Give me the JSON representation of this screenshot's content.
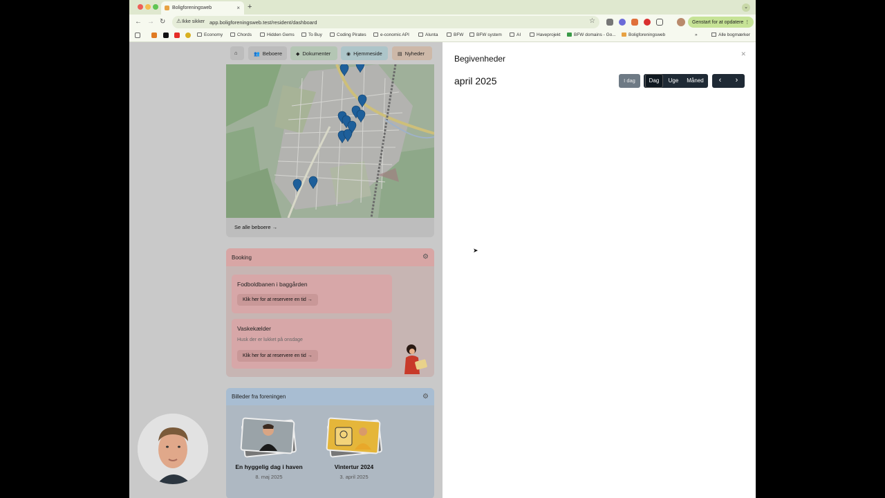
{
  "browser": {
    "tab_title": "Boligforeningsweb",
    "security_label": "Ikke sikker",
    "url": "app.boligforeningsweb.test/resident/dashboard",
    "relaunch_label": "Genstart for at opdatere",
    "bookmarks": [
      "Economy",
      "Chords",
      "Hidden Gems",
      "To Buy",
      "Coding Pirates",
      "e-conomic API",
      "Alunta",
      "BFW",
      "BFW system",
      "AI",
      "Haveprojekt",
      "BFW domains - Go...",
      "Boligforeningsweb"
    ],
    "all_bookmarks": "Alle bogmærker"
  },
  "nav": {
    "items": [
      "Beboere",
      "Dokumenter",
      "Hjemmeside",
      "Nyheder"
    ]
  },
  "map_card": {
    "see_all": "Se alle beboere →"
  },
  "booking": {
    "title": "Booking",
    "items": [
      {
        "title": "Fodboldbanen i baggården",
        "subtitle": "",
        "action": "Klik her for at reservere en tid →"
      },
      {
        "title": "Vaskekælder",
        "subtitle": "Husk der er lukket på onsdage",
        "action": "Klik her for at reservere en tid →"
      }
    ]
  },
  "photos": {
    "title": "Billeder fra foreningen",
    "albums": [
      {
        "title": "En hyggelig dag i haven",
        "date": "8. maj 2025"
      },
      {
        "title": "Vintertur 2024",
        "date": "3. april 2025"
      }
    ]
  },
  "events_panel": {
    "title": "Begivenheder",
    "month": "april 2025",
    "today_label": "I dag",
    "views": [
      "Dag",
      "Uge",
      "Måned"
    ],
    "active_view": "Dag",
    "prev": "‹",
    "next": "›"
  }
}
